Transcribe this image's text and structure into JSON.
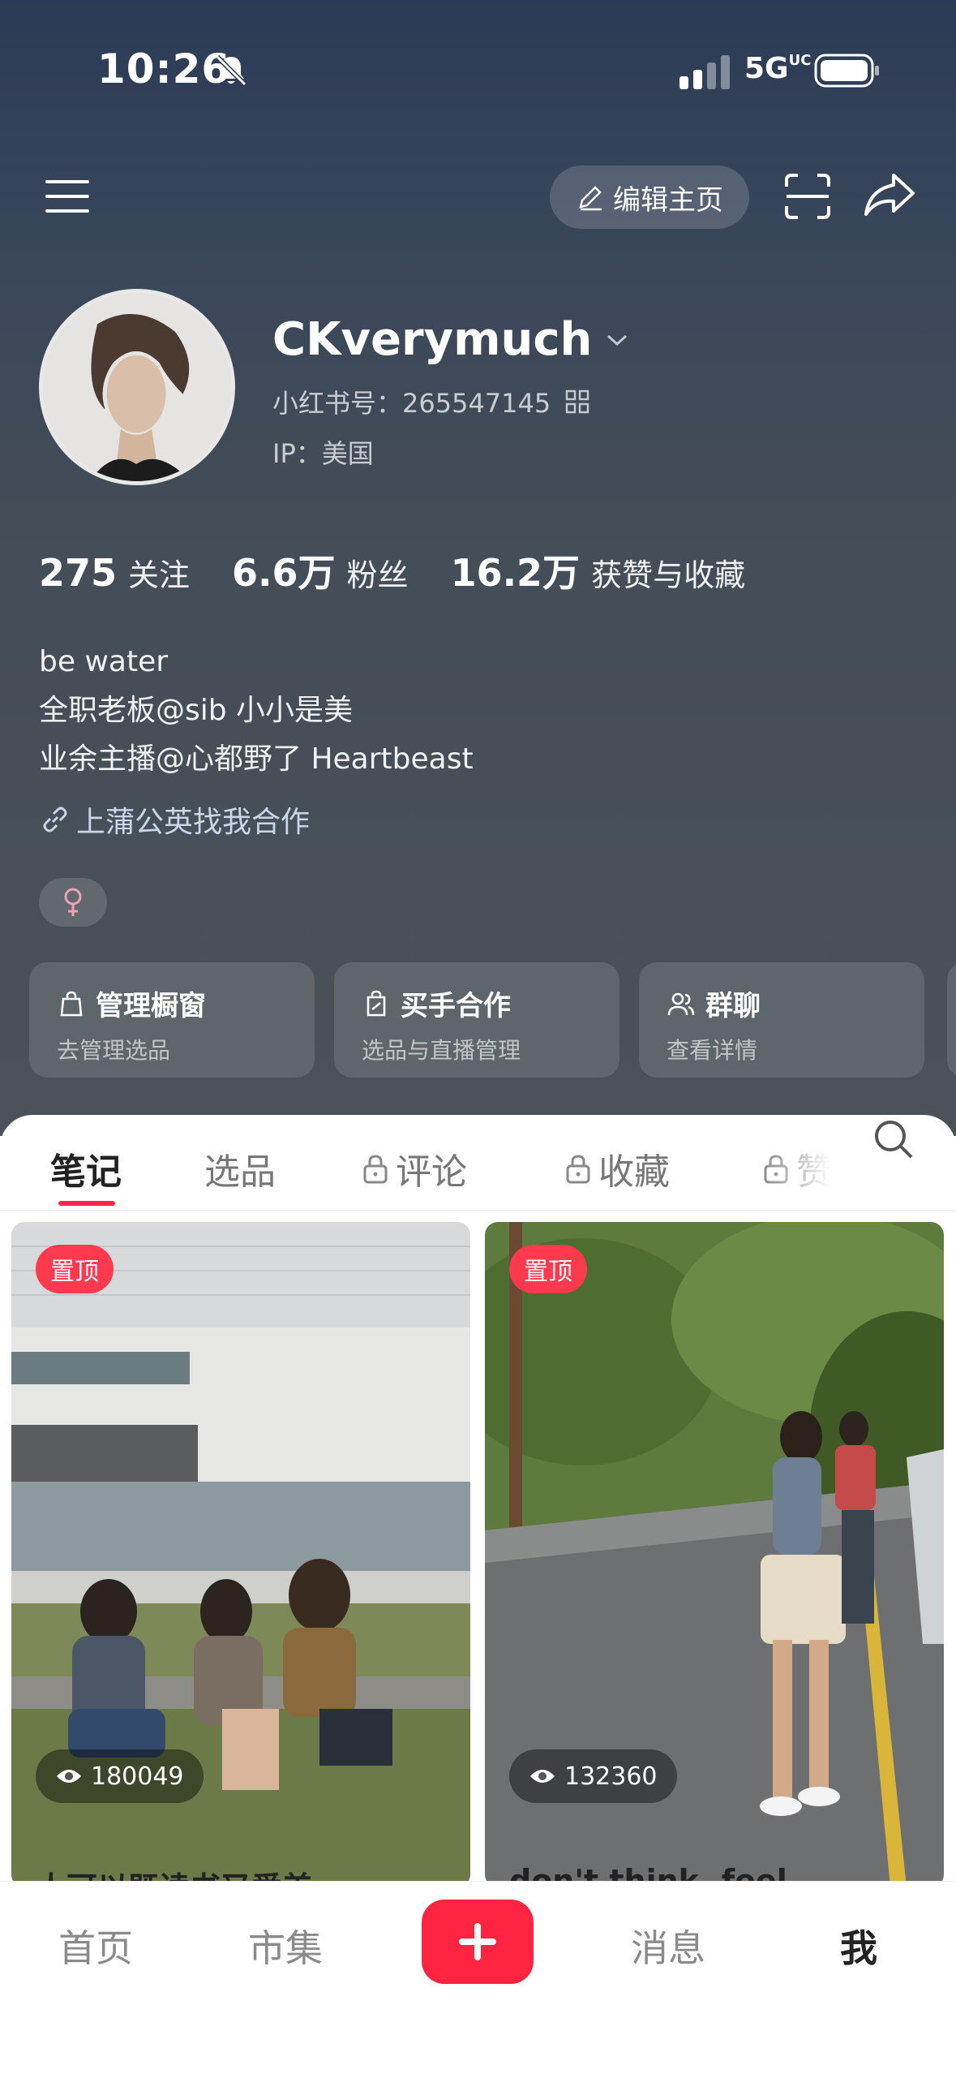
{
  "status_bar": {
    "time": "10:26",
    "network": "5G",
    "network_sub": "UC"
  },
  "header": {
    "edit_label": "编辑主页"
  },
  "profile": {
    "name": "CKverymuch",
    "red_id": "小红书号：265547145",
    "ip": "IP：美国",
    "stats": [
      {
        "num": "275",
        "label": "关注"
      },
      {
        "num": "6.6万",
        "label": "粉丝"
      },
      {
        "num": "16.2万",
        "label": "获赞与收藏"
      }
    ],
    "bio": [
      "be water",
      "全职老板@sib 小小是美",
      "业余主播@心都野了 Heartbeast"
    ],
    "link": "上蒲公英找我合作"
  },
  "cards": [
    {
      "title": "管理橱窗",
      "sub": "去管理选品",
      "icon": "bag-icon"
    },
    {
      "title": "买手合作",
      "sub": "选品与直播管理",
      "icon": "handbag-icon"
    },
    {
      "title": "群聊",
      "sub": "查看详情",
      "icon": "group-icon"
    }
  ],
  "tabs": [
    {
      "label": "笔记",
      "active": true,
      "locked": false
    },
    {
      "label": "选品",
      "active": false,
      "locked": false
    },
    {
      "label": "评论",
      "active": false,
      "locked": true
    },
    {
      "label": "收藏",
      "active": false,
      "locked": true
    },
    {
      "label": "赞",
      "active": false,
      "locked": true
    }
  ],
  "notes": [
    {
      "pin": "置顶",
      "views": "180049",
      "title": "人可以既读书又爱美"
    },
    {
      "pin": "置顶",
      "views": "132360",
      "title": "don't think, feel"
    }
  ],
  "bottom_nav": [
    {
      "label": "首页"
    },
    {
      "label": "市集"
    },
    {
      "label": "消息"
    },
    {
      "label": "我"
    }
  ],
  "colors": {
    "accent": "#ff2442",
    "hero_bg": "#3c4756"
  }
}
